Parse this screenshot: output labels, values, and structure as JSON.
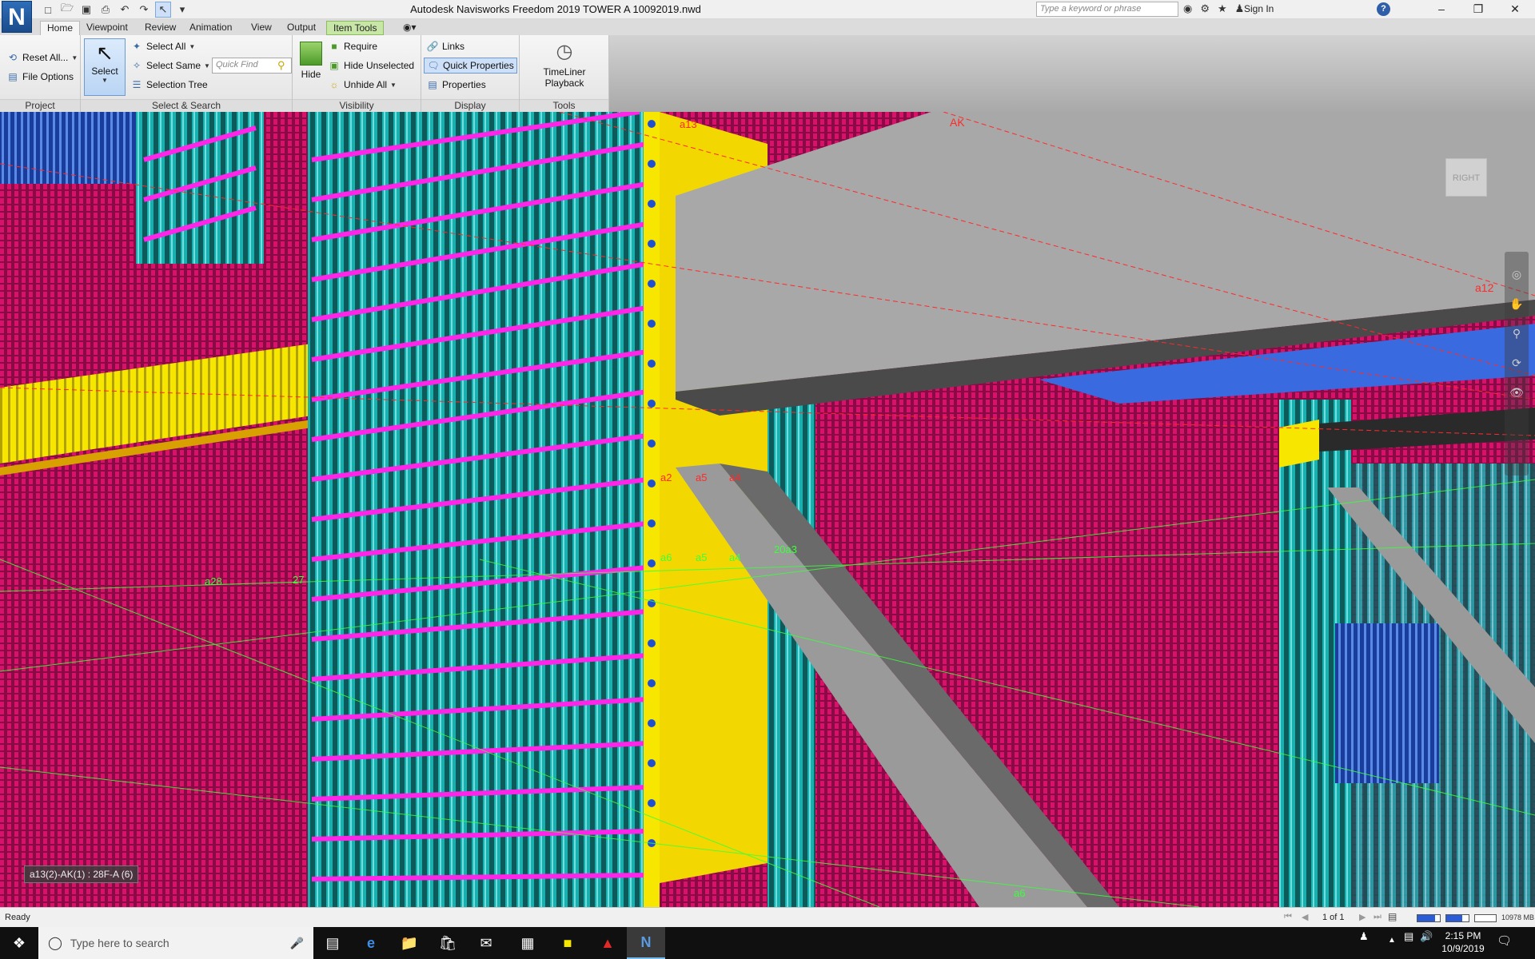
{
  "app": {
    "logo_letter": "N",
    "title": "Autodesk Navisworks Freedom 2019    TOWER A 10092019.nwd"
  },
  "titlebar": {
    "search_placeholder": "Type a keyword or phrase",
    "sign_in": "Sign In",
    "help": "?"
  },
  "tabs": [
    "Home",
    "Viewpoint",
    "Review",
    "Animation",
    "View",
    "Output",
    "Item Tools"
  ],
  "ribbon": {
    "project": {
      "label": "Project",
      "reset_all": "Reset All...",
      "file_options": "File Options"
    },
    "select_search": {
      "label": "Select & Search",
      "select": "Select",
      "select_all": "Select All",
      "select_same": "Select Same",
      "selection_tree": "Selection Tree",
      "quick_find_placeholder": "Quick Find"
    },
    "visibility": {
      "label": "Visibility",
      "hide": "Hide",
      "require": "Require",
      "hide_unselected": "Hide Unselected",
      "unhide_all": "Unhide All"
    },
    "display": {
      "label": "Display",
      "links": "Links",
      "quick_properties": "Quick Properties",
      "properties": "Properties"
    },
    "tools": {
      "label": "Tools",
      "timeliner_playback": "TimeLiner Playback"
    }
  },
  "viewport": {
    "tooltip": "a13(2)-AK(1) : 28F-A (6)",
    "viewcube_face": "RIGHT",
    "grid_labels": [
      {
        "text": "AK",
        "color": "#ff2a2a"
      },
      {
        "text": "a12",
        "color": "#ff2a2a"
      },
      {
        "text": "a13",
        "color": "#ff2a2a"
      },
      {
        "text": "a2",
        "color": "#ff2a2a"
      },
      {
        "text": "a5",
        "color": "#ff2a2a"
      },
      {
        "text": "a4",
        "color": "#ff2a2a"
      },
      {
        "text": "a28",
        "color": "#3cff3c"
      },
      {
        "text": "27",
        "color": "#3cff3c"
      },
      {
        "text": "a6",
        "color": "#3cff3c"
      },
      {
        "text": "a5",
        "color": "#3cff3c"
      },
      {
        "text": "a4",
        "color": "#3cff3c"
      },
      {
        "text": "20a3",
        "color": "#3cff3c"
      },
      {
        "text": "a6",
        "color": "#3cff3c"
      }
    ]
  },
  "statusbar": {
    "status": "Ready",
    "page": "1 of 1",
    "memory": "10978 MB"
  },
  "taskbar": {
    "search_placeholder": "Type here to search",
    "time": "2:15 PM",
    "date": "10/9/2019"
  },
  "colors": {
    "rebar_magenta": "#d8126b",
    "rebar_cyan": "#1ab0b0",
    "stirrup_pink": "#ff24e8",
    "plate_yellow": "#f7e600",
    "beam_gray": "#a8a8a8",
    "grid_red": "#ff2a2a",
    "grid_green": "#3cff3c"
  }
}
